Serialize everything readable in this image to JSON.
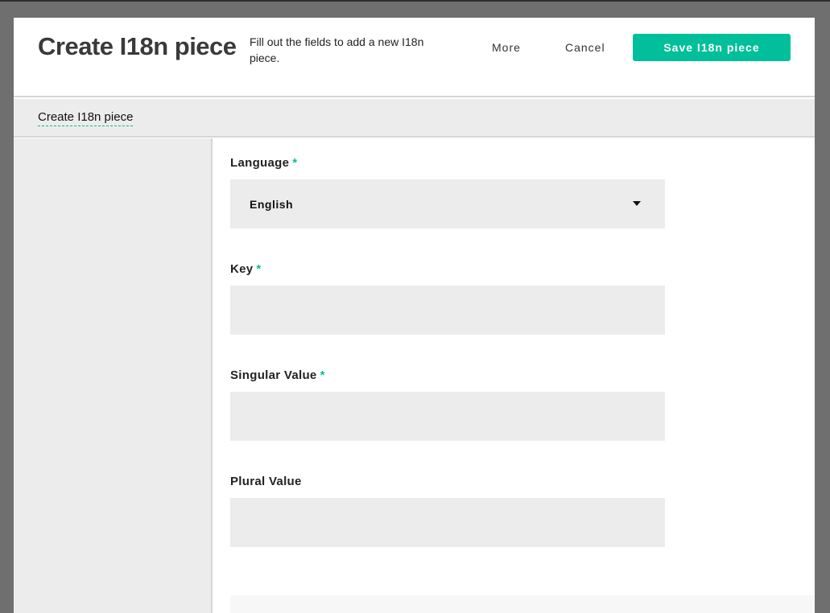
{
  "header": {
    "title": "Create I18n piece",
    "description": "Fill out the fields to add a new I18n piece.",
    "more_label": "More",
    "cancel_label": "Cancel",
    "save_label": "Save I18n piece"
  },
  "tabs": [
    {
      "label": "Create I18n piece",
      "active": true
    }
  ],
  "form": {
    "language": {
      "label": "Language",
      "required_mark": "*",
      "value": "English"
    },
    "key": {
      "label": "Key",
      "required_mark": "*",
      "value": "",
      "placeholder": ""
    },
    "singular": {
      "label": "Singular Value",
      "required_mark": "*",
      "value": "",
      "placeholder": ""
    },
    "plural": {
      "label": "Plural Value",
      "value": "",
      "placeholder": ""
    }
  },
  "colors": {
    "accent": "#00bf9a",
    "backdrop": "#6f6f6f",
    "field_bg": "#ececec"
  }
}
